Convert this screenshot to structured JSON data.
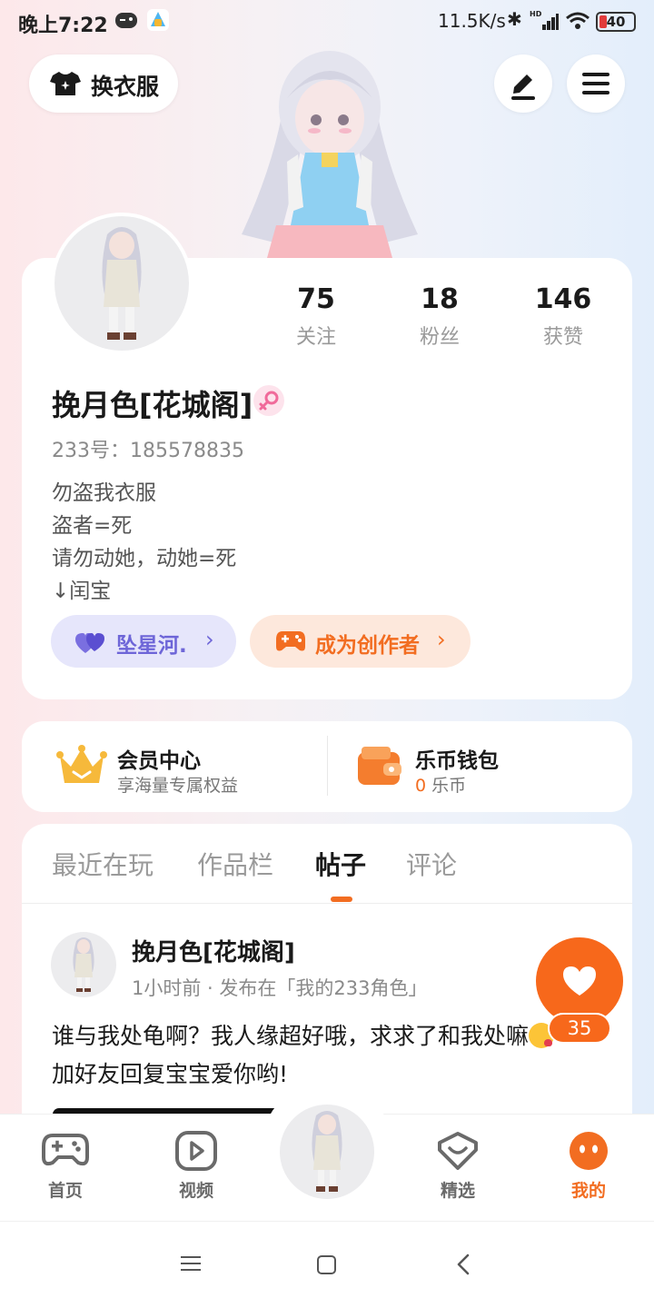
{
  "status_bar": {
    "time": "晚上7:22",
    "speed": "11.5K/s",
    "battery": "40",
    "bluetooth_glyph": "✱",
    "hd_label": "HD"
  },
  "top_bar": {
    "wardrobe_label": "换衣服"
  },
  "profile": {
    "stats": [
      {
        "value": "75",
        "label": "关注"
      },
      {
        "value": "18",
        "label": "粉丝"
      },
      {
        "value": "146",
        "label": "获赞"
      }
    ],
    "username": "挽月色[花城阁]",
    "uid": "233号：185578835",
    "bio": [
      "勿盗我衣服",
      "盗者=死",
      "请勿动她，动她=死",
      "↓闰宝"
    ],
    "pill_star": {
      "label": "坠星河.",
      "chevron": "›"
    },
    "pill_creator": {
      "label": "成为创作者",
      "chevron": "›"
    }
  },
  "member": {
    "title": "会员中心",
    "subtitle": "享海量专属权益"
  },
  "wallet": {
    "title": "乐币钱包",
    "amount": "0",
    "unit": " 乐币"
  },
  "tabs": [
    {
      "label": "最近在玩",
      "active": false
    },
    {
      "label": "作品栏",
      "active": false
    },
    {
      "label": "帖子",
      "active": true
    },
    {
      "label": "评论",
      "active": false
    }
  ],
  "post": {
    "author": "挽月色[花城阁]",
    "meta": "1小时前 · 发布在「我的233角色」",
    "text_before": "谁与我处龟啊？我人缘超好哦，求求了和我处",
    "text_mid": "嘛",
    "text_after": "加好友回复宝宝爱你哟!",
    "like_count": "35"
  },
  "bottom_nav": [
    {
      "label": "首页",
      "active": false
    },
    {
      "label": "视频",
      "active": false
    },
    {
      "label": "精选",
      "active": false
    },
    {
      "label": "我的",
      "active": true
    }
  ],
  "colors": {
    "accent": "#f26d21",
    "purple": "#6e66d8",
    "gold": "#f5b731"
  }
}
